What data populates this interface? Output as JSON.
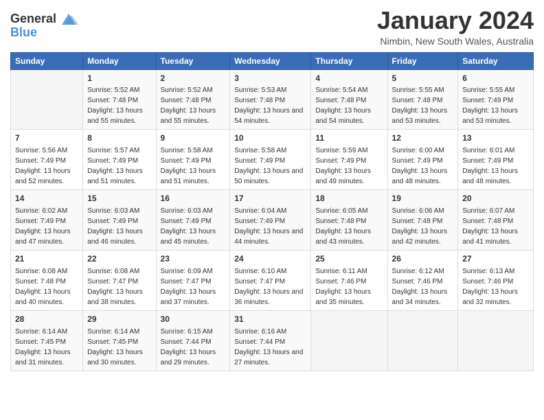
{
  "logo": {
    "text_general": "General",
    "text_blue": "Blue"
  },
  "header": {
    "title": "January 2024",
    "location": "Nimbin, New South Wales, Australia"
  },
  "weekdays": [
    "Sunday",
    "Monday",
    "Tuesday",
    "Wednesday",
    "Thursday",
    "Friday",
    "Saturday"
  ],
  "weeks": [
    [
      {
        "day": null,
        "sunrise": null,
        "sunset": null,
        "daylight": null
      },
      {
        "day": "1",
        "sunrise": "5:52 AM",
        "sunset": "7:48 PM",
        "daylight": "13 hours and 55 minutes."
      },
      {
        "day": "2",
        "sunrise": "5:52 AM",
        "sunset": "7:48 PM",
        "daylight": "13 hours and 55 minutes."
      },
      {
        "day": "3",
        "sunrise": "5:53 AM",
        "sunset": "7:48 PM",
        "daylight": "13 hours and 54 minutes."
      },
      {
        "day": "4",
        "sunrise": "5:54 AM",
        "sunset": "7:48 PM",
        "daylight": "13 hours and 54 minutes."
      },
      {
        "day": "5",
        "sunrise": "5:55 AM",
        "sunset": "7:48 PM",
        "daylight": "13 hours and 53 minutes."
      },
      {
        "day": "6",
        "sunrise": "5:55 AM",
        "sunset": "7:49 PM",
        "daylight": "13 hours and 53 minutes."
      }
    ],
    [
      {
        "day": "7",
        "sunrise": "5:56 AM",
        "sunset": "7:49 PM",
        "daylight": "13 hours and 52 minutes."
      },
      {
        "day": "8",
        "sunrise": "5:57 AM",
        "sunset": "7:49 PM",
        "daylight": "13 hours and 51 minutes."
      },
      {
        "day": "9",
        "sunrise": "5:58 AM",
        "sunset": "7:49 PM",
        "daylight": "13 hours and 51 minutes."
      },
      {
        "day": "10",
        "sunrise": "5:58 AM",
        "sunset": "7:49 PM",
        "daylight": "13 hours and 50 minutes."
      },
      {
        "day": "11",
        "sunrise": "5:59 AM",
        "sunset": "7:49 PM",
        "daylight": "13 hours and 49 minutes."
      },
      {
        "day": "12",
        "sunrise": "6:00 AM",
        "sunset": "7:49 PM",
        "daylight": "13 hours and 48 minutes."
      },
      {
        "day": "13",
        "sunrise": "6:01 AM",
        "sunset": "7:49 PM",
        "daylight": "13 hours and 48 minutes."
      }
    ],
    [
      {
        "day": "14",
        "sunrise": "6:02 AM",
        "sunset": "7:49 PM",
        "daylight": "13 hours and 47 minutes."
      },
      {
        "day": "15",
        "sunrise": "6:03 AM",
        "sunset": "7:49 PM",
        "daylight": "13 hours and 46 minutes."
      },
      {
        "day": "16",
        "sunrise": "6:03 AM",
        "sunset": "7:49 PM",
        "daylight": "13 hours and 45 minutes."
      },
      {
        "day": "17",
        "sunrise": "6:04 AM",
        "sunset": "7:49 PM",
        "daylight": "13 hours and 44 minutes."
      },
      {
        "day": "18",
        "sunrise": "6:05 AM",
        "sunset": "7:48 PM",
        "daylight": "13 hours and 43 minutes."
      },
      {
        "day": "19",
        "sunrise": "6:06 AM",
        "sunset": "7:48 PM",
        "daylight": "13 hours and 42 minutes."
      },
      {
        "day": "20",
        "sunrise": "6:07 AM",
        "sunset": "7:48 PM",
        "daylight": "13 hours and 41 minutes."
      }
    ],
    [
      {
        "day": "21",
        "sunrise": "6:08 AM",
        "sunset": "7:48 PM",
        "daylight": "13 hours and 40 minutes."
      },
      {
        "day": "22",
        "sunrise": "6:08 AM",
        "sunset": "7:47 PM",
        "daylight": "13 hours and 38 minutes."
      },
      {
        "day": "23",
        "sunrise": "6:09 AM",
        "sunset": "7:47 PM",
        "daylight": "13 hours and 37 minutes."
      },
      {
        "day": "24",
        "sunrise": "6:10 AM",
        "sunset": "7:47 PM",
        "daylight": "13 hours and 36 minutes."
      },
      {
        "day": "25",
        "sunrise": "6:11 AM",
        "sunset": "7:46 PM",
        "daylight": "13 hours and 35 minutes."
      },
      {
        "day": "26",
        "sunrise": "6:12 AM",
        "sunset": "7:46 PM",
        "daylight": "13 hours and 34 minutes."
      },
      {
        "day": "27",
        "sunrise": "6:13 AM",
        "sunset": "7:46 PM",
        "daylight": "13 hours and 32 minutes."
      }
    ],
    [
      {
        "day": "28",
        "sunrise": "6:14 AM",
        "sunset": "7:45 PM",
        "daylight": "13 hours and 31 minutes."
      },
      {
        "day": "29",
        "sunrise": "6:14 AM",
        "sunset": "7:45 PM",
        "daylight": "13 hours and 30 minutes."
      },
      {
        "day": "30",
        "sunrise": "6:15 AM",
        "sunset": "7:44 PM",
        "daylight": "13 hours and 29 minutes."
      },
      {
        "day": "31",
        "sunrise": "6:16 AM",
        "sunset": "7:44 PM",
        "daylight": "13 hours and 27 minutes."
      },
      null,
      null,
      null
    ]
  ],
  "labels": {
    "sunrise": "Sunrise:",
    "sunset": "Sunset:",
    "daylight": "Daylight:"
  }
}
